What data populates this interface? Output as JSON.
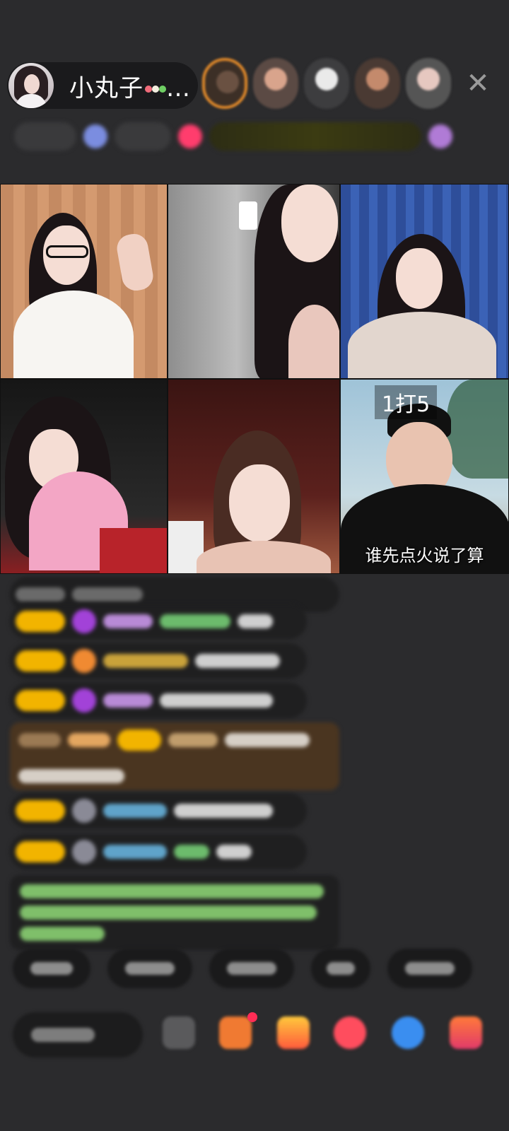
{
  "header": {
    "host_name": "小丸子",
    "host_name_suffix": "…",
    "close_glyph": "✕"
  },
  "video_grid": {
    "pk_label": "1打5",
    "caption": "谁先点火说了算"
  },
  "colors": {
    "background": "#2b2b2d",
    "badge_yellow": "#f2b400",
    "accent_orange": "#e28a2a"
  },
  "icons": {
    "close": "close-icon",
    "dango": "dango-icon"
  }
}
